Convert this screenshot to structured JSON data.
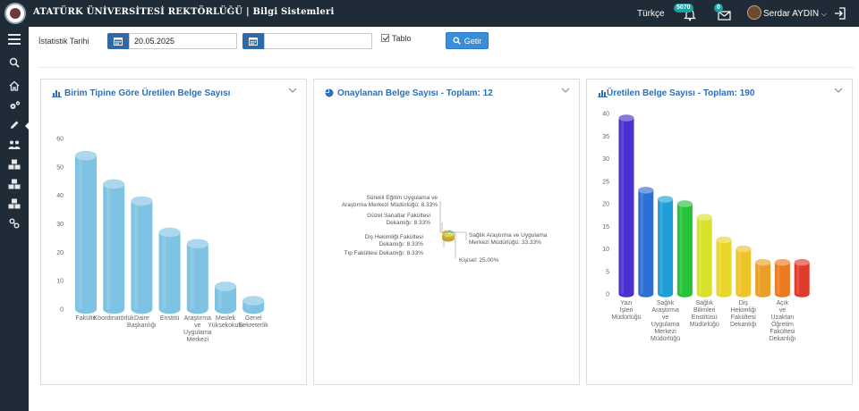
{
  "header": {
    "title": "ATATÜRK ÜNİVERSİTESİ REKTÖRLÜĞÜ | Bilgi Sistemleri",
    "language": "Türkçe",
    "notifications_count": "5070",
    "messages_count": "0",
    "user_name": "Serdar AYDIN"
  },
  "sidebar": {
    "items": [
      {
        "icon": "menu-icon"
      },
      {
        "icon": "search-icon"
      },
      {
        "icon": "home-icon"
      },
      {
        "icon": "gears-icon"
      },
      {
        "icon": "pencil-icon"
      },
      {
        "icon": "users-icon"
      },
      {
        "icon": "cubes-icon"
      },
      {
        "icon": "cubes-icon"
      },
      {
        "icon": "cubes-icon"
      },
      {
        "icon": "link-icon"
      }
    ]
  },
  "filter": {
    "label": "İstatistik Tarihi",
    "start_date": "20.05.2025",
    "end_date": "",
    "checkbox_label": "Tablo",
    "checkbox_checked": true,
    "submit_label": "Getir"
  },
  "panels": [
    {
      "title": "Birim Tipine Göre Üretilen Belge Sayısı"
    },
    {
      "title": "Onaylanan Belge Sayısı - Toplam: 12"
    },
    {
      "title": "Üretilen Belge Sayısı - Toplam: 190"
    }
  ],
  "colors": {
    "topbar": "#1f2c38",
    "accent": "#2f6fb5",
    "button": "#3a8ddc"
  },
  "chart_data": [
    {
      "type": "bar",
      "title": "Birim Tipine Göre Üretilen Belge Sayısı",
      "categories": [
        [
          "Fakülte"
        ],
        [
          "Koordinatörlük"
        ],
        [
          "Daire",
          "Başkanlığı"
        ],
        [
          "Enstitü"
        ],
        [
          "Araştırma",
          "ve",
          "Uygulama",
          "Merkezi"
        ],
        [
          "Meslek",
          "Yüksekokulu"
        ],
        [
          "Genel",
          "Sekreterlik"
        ]
      ],
      "values": [
        54,
        44,
        38,
        27,
        23,
        8,
        3
      ],
      "yticks": [
        0,
        10,
        20,
        30,
        40,
        50,
        60
      ],
      "ylim": [
        0,
        60
      ],
      "color": "#7ec3e3"
    },
    {
      "type": "pie",
      "title": "Onaylanan Belge Sayısı - Toplam: 12",
      "slices": [
        {
          "label": [
            "Sürekli Eğitim Uygulama ve",
            "Araştırma Merkezi Müdürlüğü: 8.33%"
          ],
          "value": 8.33,
          "color": "#4f94cd"
        },
        {
          "label": [
            "Güzel Sanatlar Fakültesi",
            "Dekanlığı: 8.33%"
          ],
          "value": 8.33,
          "color": "#7ec3e3"
        },
        {
          "label": [
            "Diş Hekimliği Fakültesi",
            "Dekanlığı: 8.33%"
          ],
          "value": 8.33,
          "color": "#9ad14b"
        },
        {
          "label": [
            "Tıp Fakültesi Dekanlığı: 8.33%"
          ],
          "value": 8.33,
          "color": "#e8c33a"
        },
        {
          "label": [
            "Sağlık Araştırma ve Uygulama",
            "Merkezi Müdürlüğü: 33.33%"
          ],
          "value": 33.33,
          "color": "#cfd93a"
        },
        {
          "label": [
            "Kişisel: 25.00%"
          ],
          "value": 25.0,
          "color": "#e6b82e"
        }
      ]
    },
    {
      "type": "bar",
      "title": "Üretilen Belge Sayısı - Toplam: 190",
      "categories": [
        [
          "Yazı",
          "İşleri",
          "Müdürlüğü"
        ],
        [],
        [
          "Sağlık",
          "Araştırma",
          "ve",
          "Uygulama",
          "Merkezi",
          "Müdürlüğü"
        ],
        [],
        [
          "Sağlık",
          "Bilimleri",
          "Enstitüsü",
          "Müdürlüğü"
        ],
        [],
        [
          "Diş",
          "Hekimliği",
          "Fakültesi",
          "Dekanlığı"
        ],
        [],
        [
          "Açık",
          "ve",
          "Uzaktan",
          "Öğretim",
          "Fakültesi",
          "Dekanlığı"
        ],
        []
      ],
      "values": [
        39,
        23,
        21,
        20,
        17,
        12,
        10,
        7,
        7,
        7
      ],
      "colors": [
        "#4a2fd1",
        "#2c6fd6",
        "#1f9ed8",
        "#27c23a",
        "#d8e22a",
        "#e8d62a",
        "#ecc52a",
        "#ec9f27",
        "#ec7a1f",
        "#e23a2a"
      ],
      "yticks": [
        0,
        5,
        10,
        15,
        20,
        25,
        30,
        35,
        40
      ],
      "ylim": [
        0,
        40
      ]
    }
  ]
}
